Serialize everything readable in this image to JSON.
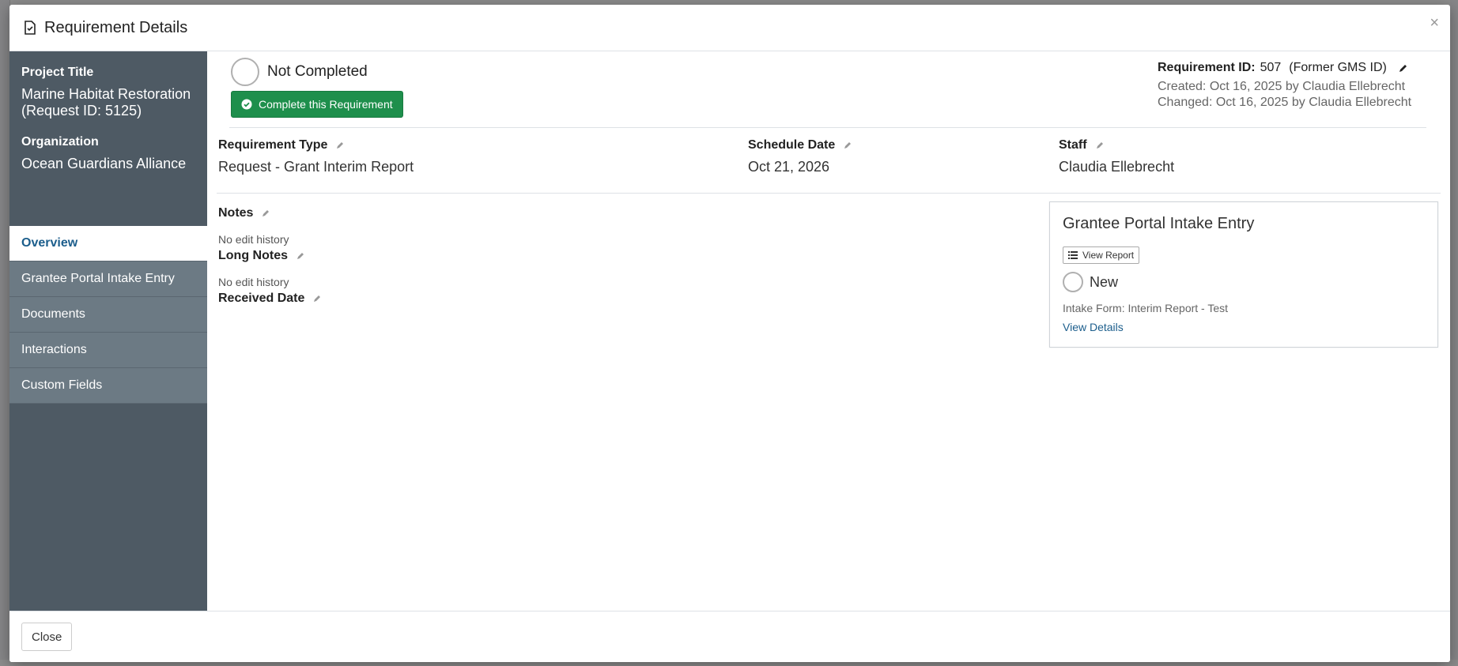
{
  "modal": {
    "title": "Requirement Details",
    "close_x": "×"
  },
  "sidebar": {
    "project_title_label": "Project Title",
    "project_title_value": "Marine Habitat Restoration (Request ID: 5125)",
    "organization_label": "Organization",
    "organization_value": "Ocean Guardians Alliance",
    "nav": [
      {
        "label": "Overview",
        "active": true
      },
      {
        "label": "Grantee Portal Intake Entry",
        "active": false
      },
      {
        "label": "Documents",
        "active": false
      },
      {
        "label": "Interactions",
        "active": false
      },
      {
        "label": "Custom Fields",
        "active": false
      }
    ]
  },
  "status": {
    "text": "Not Completed",
    "complete_button": "Complete this Requirement"
  },
  "requirement": {
    "id_label": "Requirement ID:",
    "id_value": "507",
    "former_id": "(Former GMS ID)",
    "created": "Created: Oct 16, 2025 by Claudia Ellebrecht",
    "changed": "Changed: Oct 16, 2025 by Claudia Ellebrecht"
  },
  "fields": {
    "type_label": "Requirement Type",
    "type_value": "Request - Grant Interim Report",
    "schedule_label": "Schedule Date",
    "schedule_value": "Oct 21, 2026",
    "staff_label": "Staff",
    "staff_value": "Claudia Ellebrecht"
  },
  "notes": {
    "notes_label": "Notes",
    "notes_history": "No edit history",
    "long_notes_label": "Long Notes",
    "long_notes_history": "No edit history",
    "received_label": "Received Date"
  },
  "portal_card": {
    "title": "Grantee Portal Intake Entry",
    "view_report": "View Report",
    "status": "New",
    "intake_form": "Intake Form: Interim Report - Test",
    "view_details": "View Details"
  },
  "footer": {
    "close_label": "Close"
  },
  "colors": {
    "sidebar_bg": "#4e5a64",
    "nav_bg": "#6c7a84",
    "complete_green": "#1e8f4c",
    "link_blue": "#1c5e8c"
  }
}
